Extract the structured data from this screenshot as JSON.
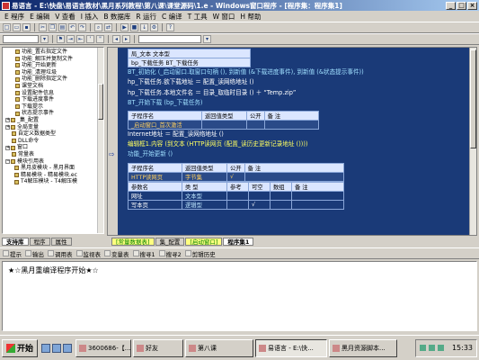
{
  "window": {
    "title": "易语言 - E:\\快盘\\易语言教材\\黑月系列教程\\第八课\\课堂源码\\1.e - Windows窗口程序 - [程序集：程序集1]"
  },
  "menu": [
    "E 程序",
    "E 编辑",
    "V 查看",
    "I 插入",
    "B 数据库",
    "R 运行",
    "C 编译",
    "T 工具",
    "W 窗口",
    "H 帮助"
  ],
  "tree": {
    "items": [
      "功能_置右指定文件",
      "功能_解压并复制文件",
      "功能_开始更新",
      "功能_清理垃圾",
      "功能_删除指定文件",
      "课堂文档",
      "设置配件信息",
      "下载进度事件",
      "下载提示",
      "状态提示事件",
      "_集_配置",
      "全局变量",
      "自定义数据类型",
      "DLL命令",
      "窗口",
      "常量表",
      "模块引用表",
      "黑月皮模块 - 黑月界面",
      "精易模块 - 精易模块.ec",
      "T4解压模块 - T4解压模"
    ],
    "section_labels": [
      "_集_配置",
      "全局变量",
      "模块引用表"
    ]
  },
  "code": {
    "lines": [
      "局_文本            文本型",
      "bp_下载任务        BT_下载任务",
      "BT_初始化 (_启动窗口.取窗口句柄 (), 到新值 (&下载进度事件), 到新值 (&状态提示事件))",
      "hp_下载任务.欲下载地址 ＝ 配置_读网络地址 ()",
      "hp_下载任务.本地文件名 ＝ 目录_取临时目录 () ＋ “Temp.zip”",
      "BT_开始下载 (bp_下载任务)"
    ],
    "sub_table": {
      "headers": [
        "子程序名",
        "返回值类型",
        "公开",
        "备 注"
      ],
      "row": [
        "_启动窗口_首次激活",
        "",
        "",
        ""
      ]
    },
    "lines2": [
      "Internet地址 ＝ 配置_读网络地址 ()",
      "编辑框1.内容 (到文本 (HTTP读网页 (配置_读历史更新记录地址 ())))",
      "功能_开始更新 ()"
    ],
    "sub_table2": {
      "headers": [
        "子程序名",
        "返回值类型",
        "公开",
        "备 注"
      ],
      "row": [
        "HTTP读网页",
        "字节集",
        "√",
        ""
      ]
    },
    "param_table": {
      "headers": [
        "参数名",
        "类 型",
        "参考",
        "可空",
        "数组",
        "备 注"
      ],
      "rows": [
        [
          "网址",
          "文本型",
          "",
          "",
          "",
          ""
        ],
        [
          "写本页",
          "逻辑型",
          "",
          "√",
          "",
          ""
        ]
      ]
    }
  },
  "tabs_left": [
    "支持库",
    "程序",
    "属性"
  ],
  "tabs_editor": [
    "[常量数据表]",
    "集_配置",
    "[启动窗口]",
    "程序集1"
  ],
  "output_toolbar": [
    "提示",
    "输出",
    "调用表",
    "监视表",
    "变量表",
    "搜寻1",
    "搜寻2",
    "剪辑历史"
  ],
  "output": {
    "text": "★☆黑月重编译程序开始★☆"
  },
  "taskbar": {
    "start": "开始",
    "tasks": [
      "3600686-【...",
      "好友",
      "第八课",
      "易语言 - E:\\快...",
      "黑月资源脚本..."
    ],
    "active_task_index": 3,
    "clock": "15:33"
  }
}
